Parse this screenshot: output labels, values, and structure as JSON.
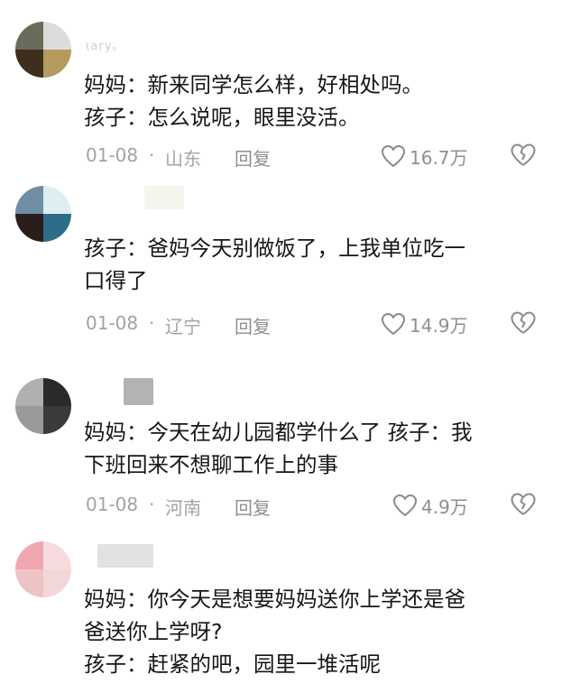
{
  "comments": [
    {
      "username": "ιary。",
      "lines": [
        "妈妈：新来同学怎么样，好相处吗。",
        "孩子：怎么说呢，眼里没活。"
      ],
      "date": "01-08",
      "separator": "·",
      "location": "山东",
      "reply_label": "回复",
      "likes": "16.7万",
      "avatar_colors": [
        "#6b6b5c",
        "#dcdcdc",
        "#3d2e1d",
        "#b59a5e"
      ]
    },
    {
      "username": "",
      "lines": [
        "孩子：爸妈今天别做饭了，上我单位吃一",
        "口得了"
      ],
      "date": "01-08",
      "separator": "·",
      "location": "辽宁",
      "reply_label": "回复",
      "likes": "14.9万",
      "avatar_colors": [
        "#6f8ea3",
        "#dfeef2",
        "#2a1e1b",
        "#2f6c8a"
      ]
    },
    {
      "username": "",
      "lines": [
        "妈妈：今天在幼儿园都学什么了 孩子：我",
        "下班回来不想聊工作上的事"
      ],
      "date": "01-08",
      "separator": "·",
      "location": "河南",
      "reply_label": "回复",
      "likes": "4.9万",
      "avatar_colors": [
        "#b0b0b0",
        "#2a2a2a",
        "#9a9a9a",
        "#3a3a3a"
      ]
    },
    {
      "username": "",
      "lines": [
        "妈妈：你今天是想要妈妈送你上学还是爸",
        "爸送你上学呀?",
        "孩子：赶紧的吧，园里一堆活呢"
      ],
      "avatar_colors": [
        "#f0a8b0",
        "#f7dcdf",
        "#eec3c5",
        "#f3d6d6"
      ]
    }
  ]
}
